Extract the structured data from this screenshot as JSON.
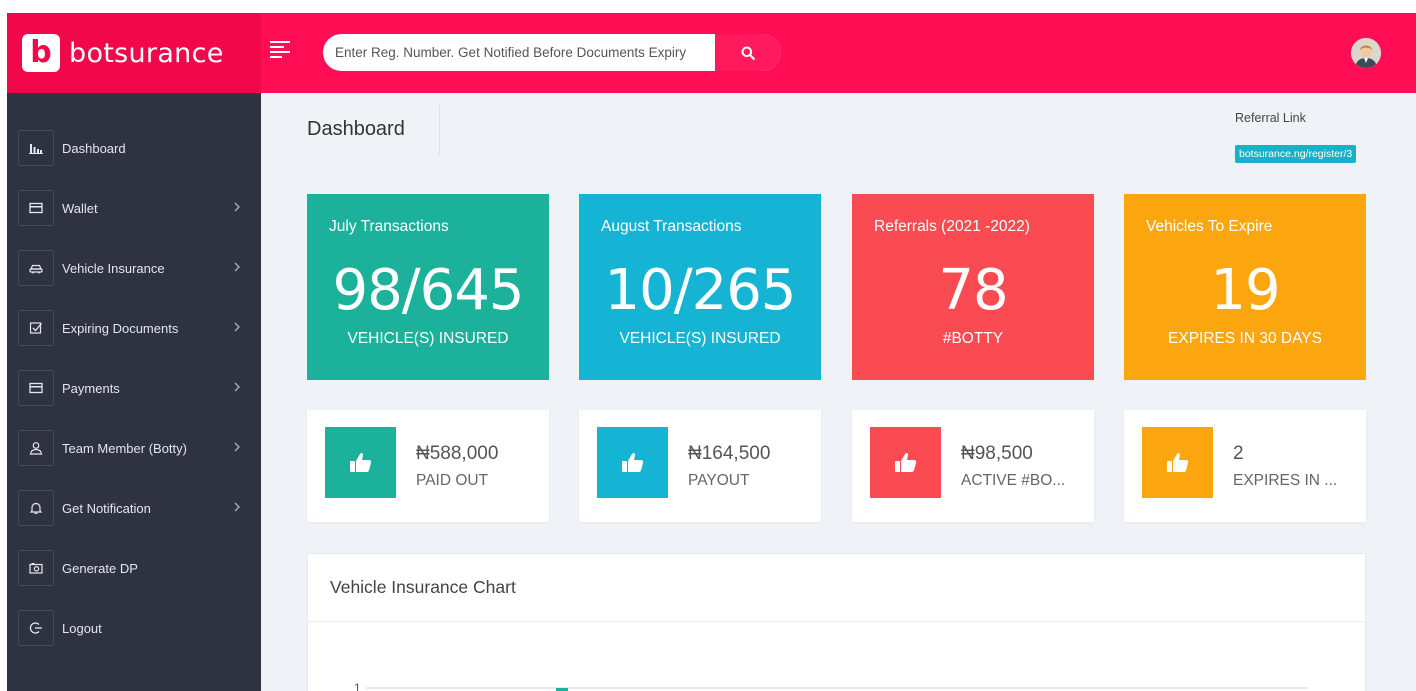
{
  "brand": {
    "logo_letter": "b",
    "name": "botsurance",
    "color": "#f2074b"
  },
  "search": {
    "placeholder": "Enter Reg. Number. Get Notified Before Documents Expiry",
    "icon": "search-icon"
  },
  "sidebar": {
    "items": [
      {
        "label": "Dashboard",
        "icon": "bar-chart-icon",
        "has_submenu": false
      },
      {
        "label": "Wallet",
        "icon": "card-icon",
        "has_submenu": true
      },
      {
        "label": "Vehicle Insurance",
        "icon": "car-icon",
        "has_submenu": true
      },
      {
        "label": "Expiring Documents",
        "icon": "checkbox-icon",
        "has_submenu": true
      },
      {
        "label": "Payments",
        "icon": "card-icon",
        "has_submenu": true
      },
      {
        "label": "Team Member (Botty)",
        "icon": "user-icon",
        "has_submenu": true
      },
      {
        "label": "Get Notification",
        "icon": "bell-icon",
        "has_submenu": true
      },
      {
        "label": "Generate DP",
        "icon": "camera-icon",
        "has_submenu": false
      },
      {
        "label": "Logout",
        "icon": "logout-icon",
        "has_submenu": false
      }
    ]
  },
  "page": {
    "title": "Dashboard"
  },
  "referral": {
    "label": "Referral Link",
    "link": "botsurance.ng/register/3"
  },
  "stats": [
    {
      "title": "July Transactions",
      "value": "98/645",
      "caption": "VEHICLE(S) INSURED",
      "color": "#1bb19b"
    },
    {
      "title": "August Transactions",
      "value": "10/265",
      "caption": "VEHICLE(S) INSURED",
      "color": "#15b3d4"
    },
    {
      "title": "Referrals (2021 -2022)",
      "value": "78",
      "caption": "#BOTTY",
      "color": "#fb4b52"
    },
    {
      "title": "Vehicles To Expire",
      "value": "19",
      "caption": "EXPIRES IN 30 DAYS",
      "color": "#fba60f"
    }
  ],
  "mini_stats": [
    {
      "amount": "₦588,000",
      "label": "PAID OUT",
      "icon": "thumbs-up-icon",
      "color": "#1bb19b"
    },
    {
      "amount": "₦164,500",
      "label": "PAYOUT",
      "icon": "thumbs-up-icon",
      "color": "#15b3d4"
    },
    {
      "amount": "₦98,500",
      "label": "ACTIVE #BO...",
      "icon": "thumbs-up-icon",
      "color": "#fb4b52"
    },
    {
      "amount": "2",
      "label": "EXPIRES IN ...",
      "icon": "thumbs-up-icon",
      "color": "#fba60f"
    }
  ],
  "chart": {
    "title": "Vehicle Insurance Chart",
    "first_tick": "1"
  }
}
